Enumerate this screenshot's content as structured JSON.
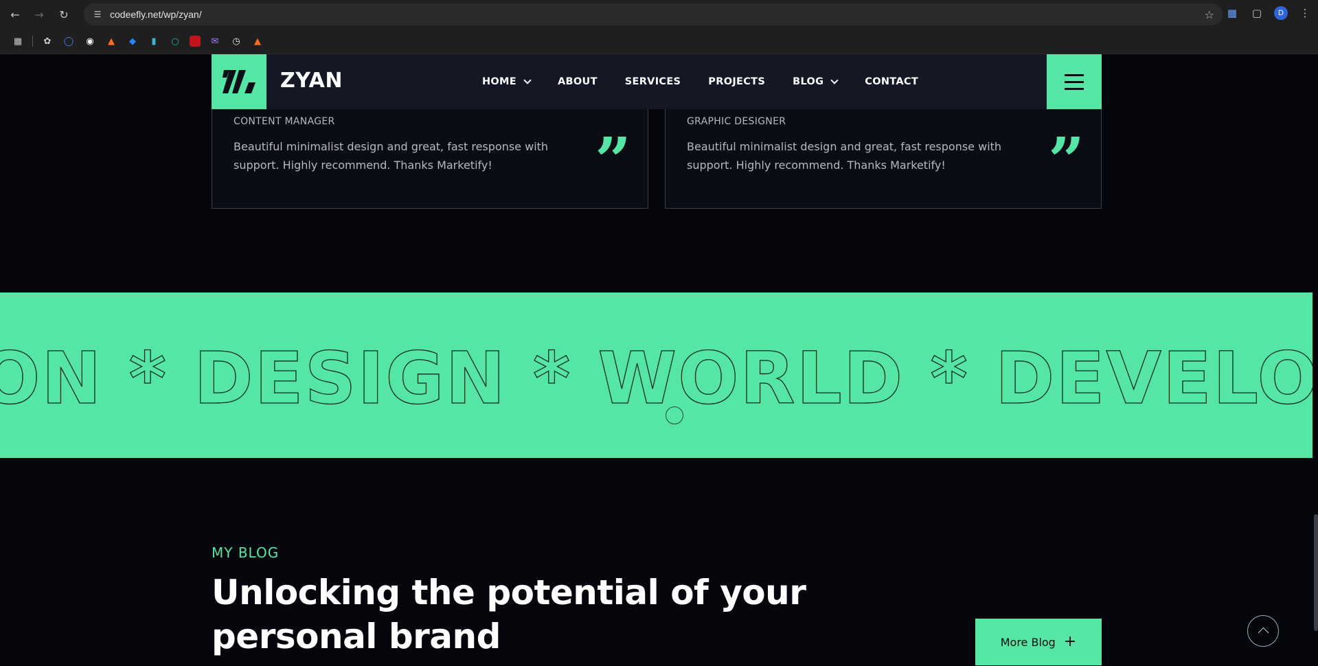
{
  "browser": {
    "url": "codeefly.net/wp/zyan/",
    "profile_initial": "D",
    "icons": [
      "back-icon",
      "forward-icon",
      "reload-icon",
      "site-info-icon",
      "bookmark-star-icon",
      "translate-icon",
      "extensions-icon",
      "menu-dots-icon"
    ],
    "bookmarks": [
      "apps-grid-icon",
      "chatgpt-icon",
      "chat-bubble-icon",
      "github-icon",
      "gitlab-icon",
      "jira-icon",
      "bookmark-b-icon",
      "teal-circle-icon",
      "red-square-icon",
      "gmail-icon",
      "clock-icon",
      "gitlab-icon-2"
    ]
  },
  "header": {
    "brand": "ZYAN",
    "menu": [
      {
        "label": "HOME",
        "dropdown": true
      },
      {
        "label": "ABOUT",
        "dropdown": false
      },
      {
        "label": "SERVICES",
        "dropdown": false
      },
      {
        "label": "PROJECTS",
        "dropdown": false
      },
      {
        "label": "BLOG",
        "dropdown": true
      },
      {
        "label": "CONTACT",
        "dropdown": false
      }
    ]
  },
  "testimonials": [
    {
      "role": "CONTENT MANAGER",
      "quote": "Beautiful minimalist design and great, fast response with support. Highly recommend. Thanks Marketify!"
    },
    {
      "role": "GRAPHIC DESIGNER",
      "quote": "Beautiful minimalist design and great, fast response with support. Highly recommend. Thanks Marketify!"
    }
  ],
  "marquee": {
    "text": "ON * DESIGN * WORLD * DEVELOPMENT"
  },
  "blog": {
    "tag": "MY BLOG",
    "title": "Unlocking the potential of your personal brand",
    "more_label": "More Blog",
    "more_icon": "plus-icon"
  },
  "colors": {
    "accent": "#55e6a5",
    "background": "#05070d",
    "header": "#141824",
    "text_muted": "#b6b9c2"
  }
}
